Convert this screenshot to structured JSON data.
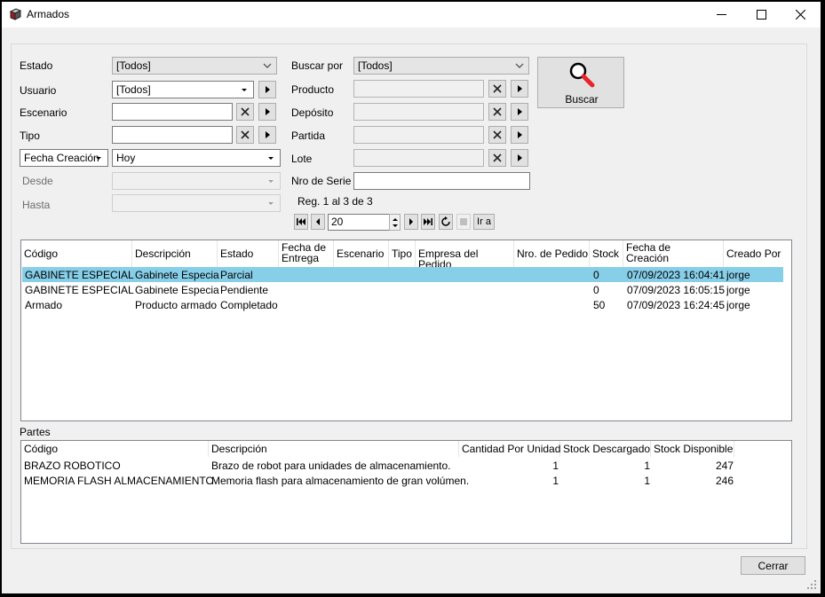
{
  "window": {
    "title": "Armados"
  },
  "filters": {
    "estado": {
      "label": "Estado",
      "value": "[Todos]"
    },
    "usuario": {
      "label": "Usuario",
      "value": "[Todos]"
    },
    "escenario": {
      "label": "Escenario",
      "value": ""
    },
    "tipo": {
      "label": "Tipo",
      "value": ""
    },
    "date_field": {
      "value": "Fecha Creación"
    },
    "date_range": {
      "value": "Hoy"
    },
    "desde": {
      "label": "Desde",
      "value": ""
    },
    "hasta": {
      "label": "Hasta",
      "value": ""
    },
    "buscar_por": {
      "label": "Buscar por",
      "value": "[Todos]"
    },
    "producto": {
      "label": "Producto",
      "value": ""
    },
    "deposito": {
      "label": "Depósito",
      "value": ""
    },
    "partida": {
      "label": "Partida",
      "value": ""
    },
    "lote": {
      "label": "Lote",
      "value": ""
    },
    "nro_serie": {
      "label": "Nro de Serie",
      "value": ""
    }
  },
  "search_button": {
    "label": "Buscar",
    "icon": "magnifier-icon"
  },
  "pager": {
    "status": "Reg. 1 al 3 de 3",
    "page_size": "20",
    "go_label": "Ir a"
  },
  "main_grid": {
    "columns": [
      "Código",
      "Descripción",
      "Estado",
      "Fecha de Entrega",
      "Escenario",
      "Tipo",
      "Empresa del Pedido",
      "Nro. de Pedido",
      "Stock",
      "Fecha de Creación",
      "Creado Por"
    ],
    "rows": [
      {
        "codigo": "GABINETE ESPECIAL",
        "descripcion": "Gabinete Especial",
        "estado": "Parcial",
        "fecha_entrega": "",
        "escenario": "",
        "tipo": "",
        "empresa": "",
        "nro_pedido": "",
        "stock": "0",
        "fecha_creacion": "07/09/2023 16:04:41",
        "creado_por": "jorge",
        "selected": true
      },
      {
        "codigo": "GABINETE ESPECIAL",
        "descripcion": "Gabinete Especial",
        "estado": "Pendiente",
        "fecha_entrega": "",
        "escenario": "",
        "tipo": "",
        "empresa": "",
        "nro_pedido": "",
        "stock": "0",
        "fecha_creacion": "07/09/2023 16:05:15",
        "creado_por": "jorge",
        "selected": false
      },
      {
        "codigo": "Armado",
        "descripcion": "Producto armado",
        "estado": "Completado",
        "fecha_entrega": "",
        "escenario": "",
        "tipo": "",
        "empresa": "",
        "nro_pedido": "",
        "stock": "50",
        "fecha_creacion": "07/09/2023 16:24:45",
        "creado_por": "jorge",
        "selected": false
      }
    ]
  },
  "parts": {
    "label": "Partes",
    "columns": [
      "Código",
      "Descripción",
      "Cantidad Por Unidad",
      "Stock Descargado",
      "Stock Disponible"
    ],
    "rows": [
      {
        "codigo": "BRAZO ROBOTICO",
        "descripcion": "Brazo de robot para unidades de almacenamiento.",
        "cantidad": "1",
        "descargado": "1",
        "disponible": "247"
      },
      {
        "codigo": "MEMORIA FLASH ALMACENAMIENTO",
        "descripcion": "Memoria flash para almacenamiento de gran volúmen.",
        "cantidad": "1",
        "descargado": "1",
        "disponible": "246"
      }
    ]
  },
  "close_button": {
    "label": "Cerrar"
  },
  "colors": {
    "selection": "#87cee8",
    "window_bg": "#f0f0f0"
  }
}
